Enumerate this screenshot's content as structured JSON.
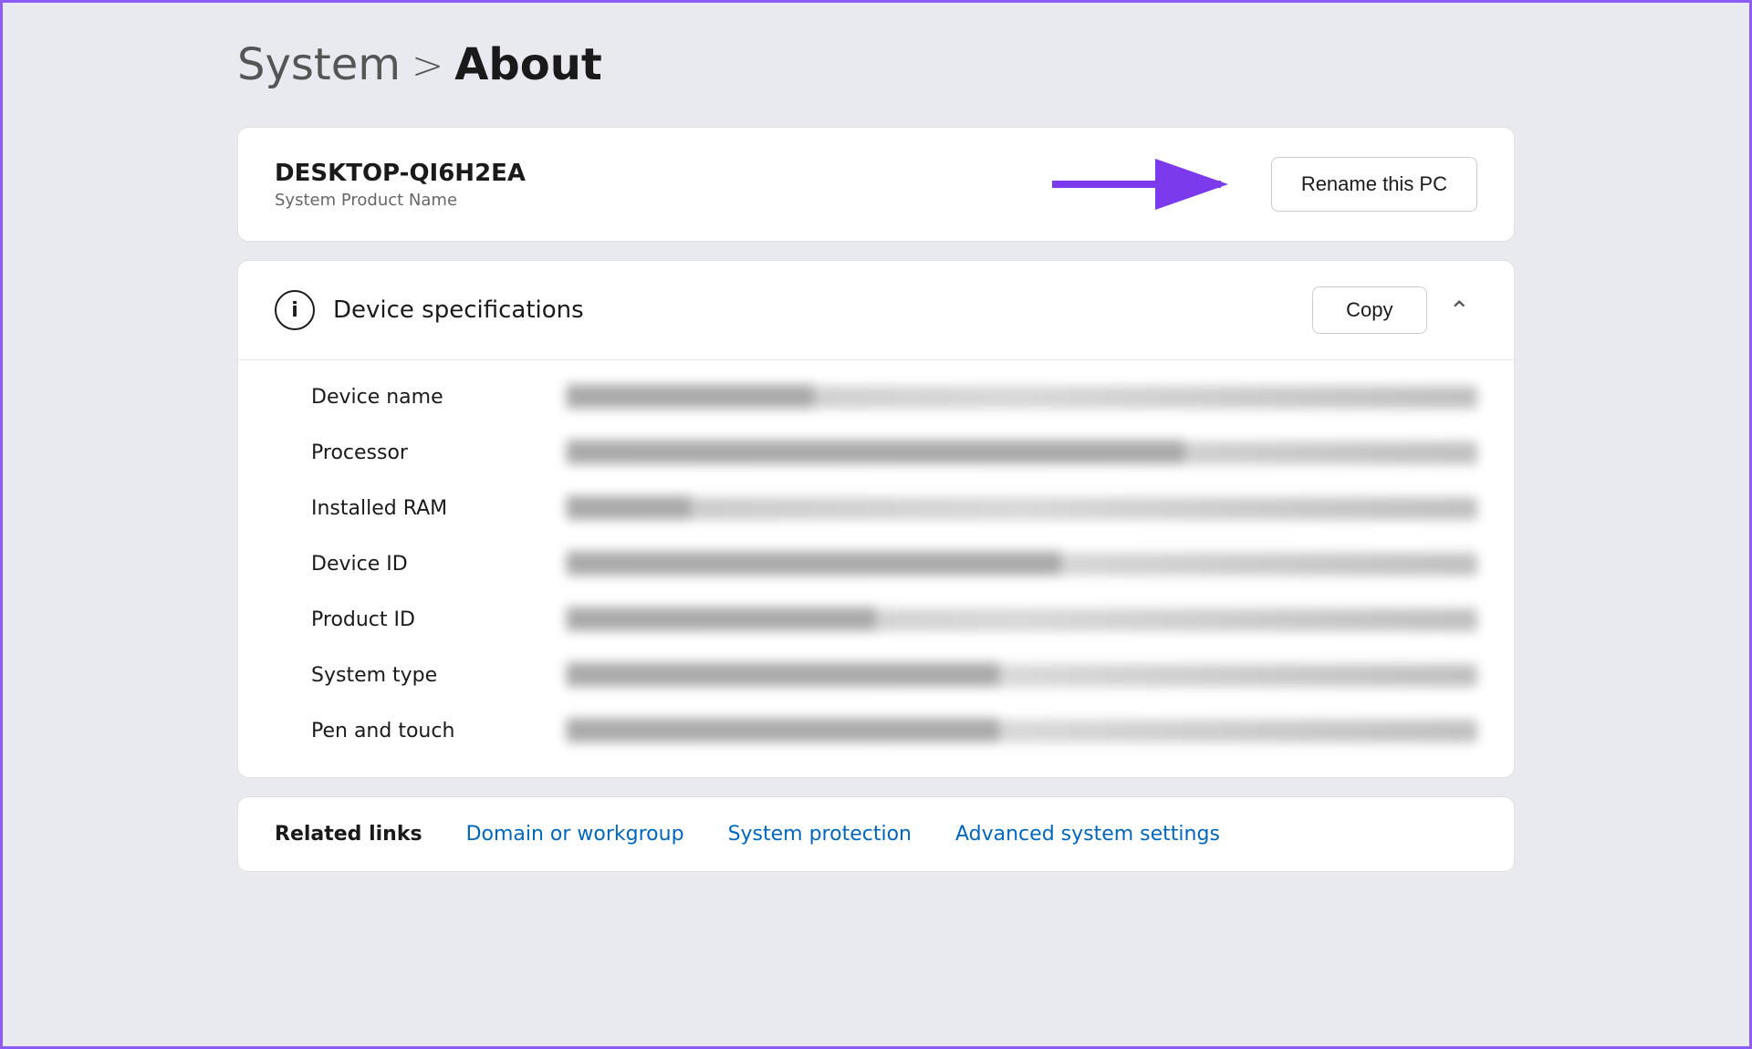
{
  "breadcrumb": {
    "system_label": "System",
    "separator": ">",
    "about_label": "About"
  },
  "pc_name_card": {
    "pc_name": "DESKTOP-QI6H2EA",
    "pc_subtitle": "System Product Name",
    "rename_btn_label": "Rename this PC"
  },
  "device_specs": {
    "section_title": "Device specifications",
    "copy_btn_label": "Copy",
    "info_icon_text": "i",
    "chevron_label": "^",
    "rows": [
      {
        "label": "Device name",
        "value": "████████████████"
      },
      {
        "label": "Processor",
        "value": "████████████████████████████████████████"
      },
      {
        "label": "Installed RAM",
        "value": "████████"
      },
      {
        "label": "Device ID",
        "value": "████████████████████████████████"
      },
      {
        "label": "Product ID",
        "value": "████████████████████"
      },
      {
        "label": "System type",
        "value": "████████████████████████████"
      },
      {
        "label": "Pen and touch",
        "value": "████████████████████████████"
      }
    ]
  },
  "related_links": {
    "label": "Related links",
    "links": [
      "Domain or workgroup",
      "System protection",
      "Advanced system settings"
    ]
  },
  "arrow": {
    "color": "#7c3aed"
  }
}
